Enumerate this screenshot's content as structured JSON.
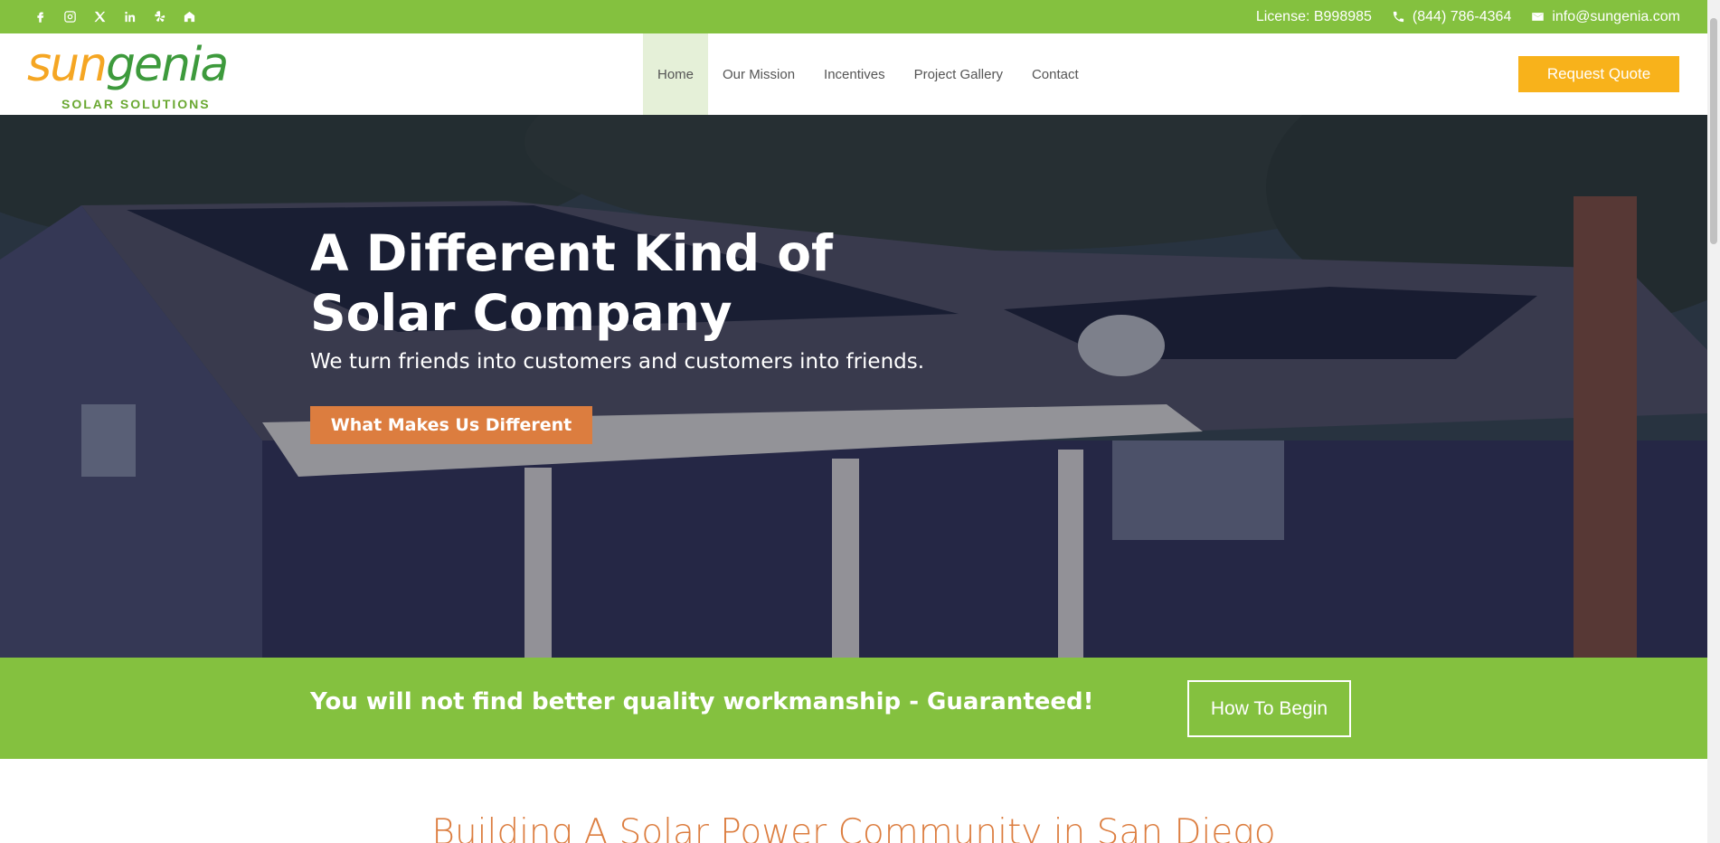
{
  "topbar": {
    "social": [
      "facebook-icon",
      "instagram-icon",
      "x-icon",
      "linkedin-icon",
      "yelp-icon",
      "houzz-icon"
    ],
    "license": "License: B998985",
    "phone": "(844) 786-4364",
    "email": "info@sungenia.com"
  },
  "header": {
    "logo": {
      "part1": "sun",
      "part2": "genia",
      "sub": "SOLAR SOLUTIONS"
    },
    "nav": [
      {
        "label": "Home",
        "active": true
      },
      {
        "label": "Our Mission",
        "active": false
      },
      {
        "label": "Incentives",
        "active": false
      },
      {
        "label": "Project Gallery",
        "active": false
      },
      {
        "label": "Contact",
        "active": false
      }
    ],
    "cta": "Request Quote"
  },
  "hero": {
    "title_line1": "A Different Kind of",
    "title_line2": "Solar Company",
    "subtitle": "We turn friends into customers and customers into friends.",
    "button": "What Makes Us Different"
  },
  "band": {
    "text": "You will not find better quality workmanship - Guaranteed!",
    "button": "How To Begin"
  },
  "section": {
    "title": "Building A Solar Power Community in San Diego"
  },
  "colors": {
    "brand_green": "#84c13f",
    "accent_orange": "#dc7d3f",
    "cta_yellow": "#f8b21b"
  }
}
